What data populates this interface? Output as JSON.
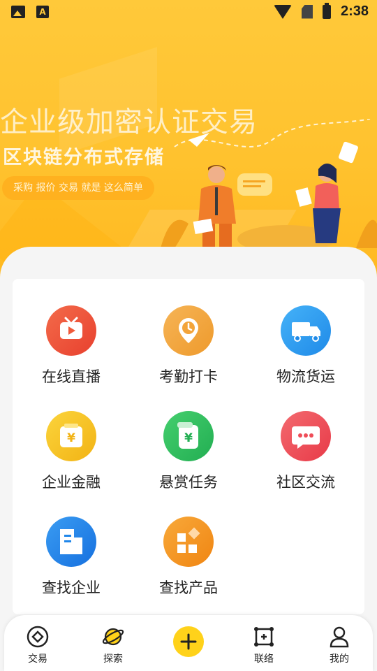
{
  "status_bar": {
    "time": "2:38",
    "left_icons": [
      "image-icon",
      "text-a-icon"
    ],
    "right_icons": [
      "wifi-icon",
      "no-sim-icon",
      "battery-charging-icon"
    ]
  },
  "banner": {
    "headline": "企业级加密认证交易",
    "subline": "区块链分布式存储",
    "pill_text": "采购 报价 交易 就是 这么简单",
    "accent": "#ffc22e"
  },
  "features": [
    {
      "label": "在线直播",
      "icon": "live-tv-icon",
      "color": "#f05a3a"
    },
    {
      "label": "考勤打卡",
      "icon": "clock-pin-icon",
      "color": "#f3a43a"
    },
    {
      "label": "物流货运",
      "icon": "truck-icon",
      "color": "#2f9ef2"
    },
    {
      "label": "企业金融",
      "icon": "wallet-yuan-icon",
      "color": "#f7c520"
    },
    {
      "label": "悬赏任务",
      "icon": "reward-yuan-icon",
      "color": "#2fc061"
    },
    {
      "label": "社区交流",
      "icon": "chat-bubble-icon",
      "color": "#ef4d58"
    },
    {
      "label": "查找企业",
      "icon": "building-icon",
      "color": "#1f86ea"
    },
    {
      "label": "查找产品",
      "icon": "product-grid-icon",
      "color": "#f5961e"
    }
  ],
  "tabbar": [
    {
      "label": "交易",
      "icon": "trade-diamond-icon"
    },
    {
      "label": "探索",
      "icon": "planet-icon"
    },
    {
      "label": "",
      "icon": "add-circle-icon",
      "color": "#ffd21a"
    },
    {
      "label": "联络",
      "icon": "contact-frame-icon"
    },
    {
      "label": "我的",
      "icon": "user-icon"
    }
  ]
}
